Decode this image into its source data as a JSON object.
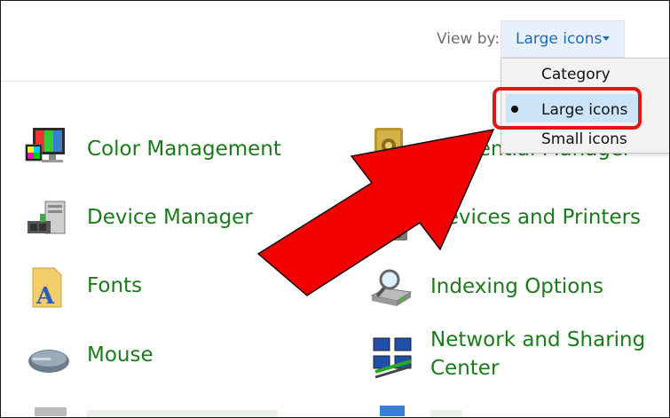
{
  "header": {
    "view_by_label": "View by:",
    "view_by_value": "Large icons"
  },
  "view_menu": {
    "options": [
      "Category",
      "Large icons",
      "Small icons"
    ],
    "selected": "Large icons"
  },
  "items": [
    {
      "label": "Color Management",
      "icon": "color-management-icon"
    },
    {
      "label": "Credential Manager",
      "icon": "credential-manager-icon"
    },
    {
      "label": "Device Manager",
      "icon": "device-manager-icon"
    },
    {
      "label": "Devices and Printers",
      "icon": "devices-printers-icon"
    },
    {
      "label": "Fonts",
      "icon": "fonts-icon"
    },
    {
      "label": "Indexing Options",
      "icon": "indexing-options-icon"
    },
    {
      "label": "Mouse",
      "icon": "mouse-icon"
    },
    {
      "label": "Network and Sharing",
      "label2": "Center",
      "icon": "network-sharing-icon"
    }
  ],
  "colors": {
    "link_green": "#1a7b1a",
    "accent_blue": "#1e6bb8",
    "annotation_red": "#e01515"
  }
}
